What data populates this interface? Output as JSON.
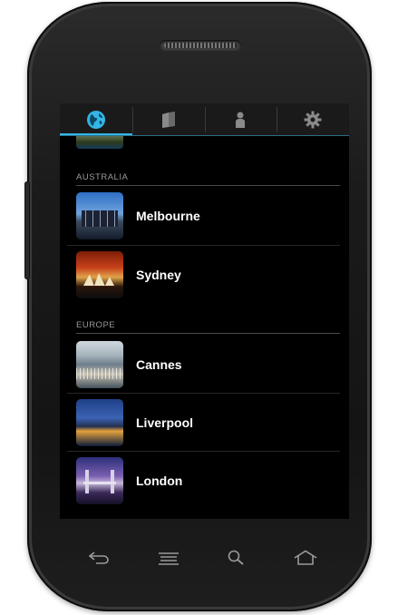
{
  "tabs": [
    {
      "name": "globe-icon",
      "active": true
    },
    {
      "name": "book-icon",
      "active": false
    },
    {
      "name": "person-icon",
      "active": false
    },
    {
      "name": "gear-icon",
      "active": false
    }
  ],
  "sections": [
    {
      "header": "AUSTRALIA",
      "items": [
        {
          "label": "Melbourne",
          "thumb": "melbourne-thumbnail"
        },
        {
          "label": "Sydney",
          "thumb": "sydney-thumbnail"
        }
      ]
    },
    {
      "header": "EUROPE",
      "items": [
        {
          "label": "Cannes",
          "thumb": "cannes-thumbnail"
        },
        {
          "label": "Liverpool",
          "thumb": "liverpool-thumbnail"
        },
        {
          "label": "London",
          "thumb": "london-thumbnail"
        }
      ]
    }
  ],
  "navbar": [
    "back-icon",
    "menu-icon",
    "search-icon",
    "home-icon"
  ],
  "colors": {
    "accent": "#33b5e5",
    "background": "#000000",
    "text": "#ffffff",
    "header_text": "#9a9a9a"
  }
}
